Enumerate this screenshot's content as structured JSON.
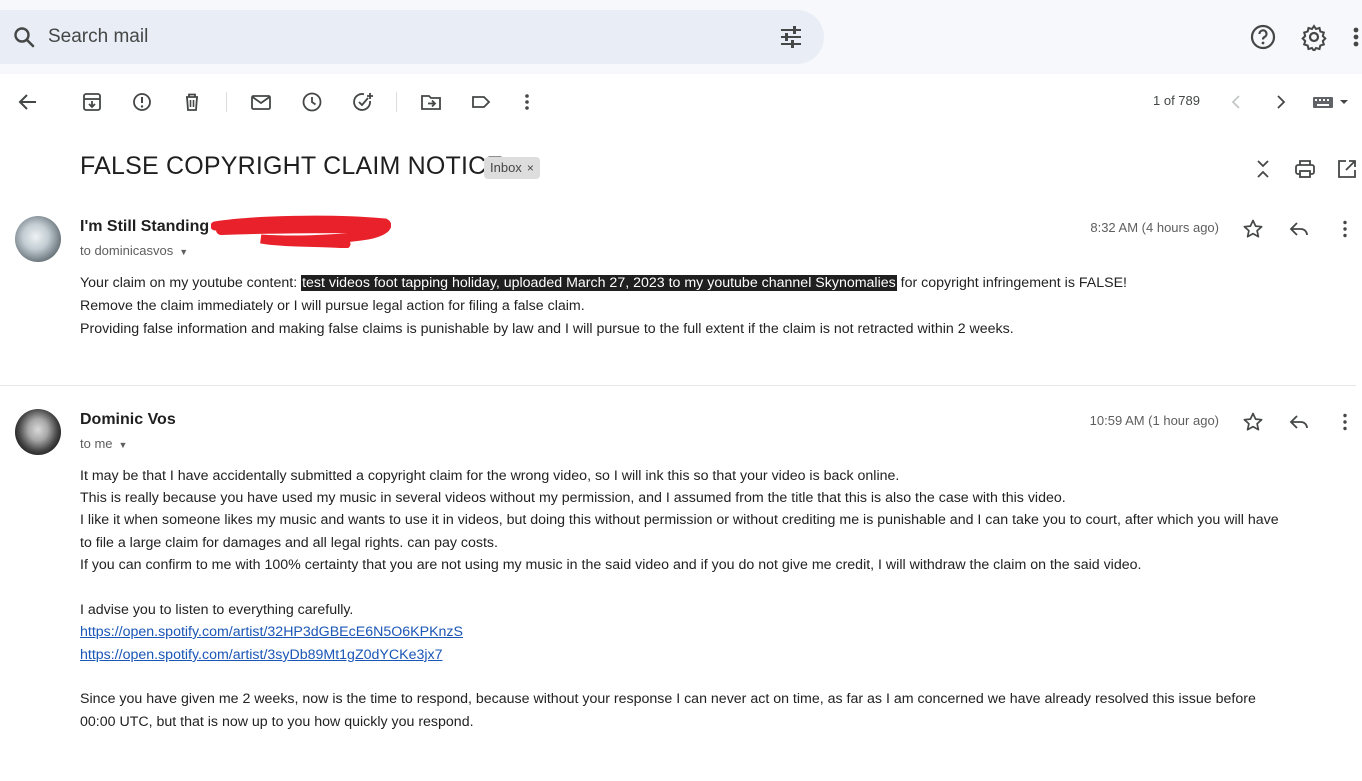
{
  "search": {
    "placeholder": "Search mail"
  },
  "toolbar": {
    "pager": "1 of 789"
  },
  "subject": "FALSE COPYRIGHT CLAIM NOTICE",
  "label": {
    "text": "Inbox",
    "close": "×"
  },
  "messages": [
    {
      "sender": "I'm Still Standing",
      "to": "to dominicasvos",
      "time": "8:32 AM (4 hours ago)",
      "lines": [
        {
          "pre": "Your claim on my youtube content: ",
          "highlight": "test videos foot tapping holiday, uploaded March 27, 2023 to my youtube channel Skynomalies",
          "post": " for copyright infringement is FALSE!"
        },
        "Remove the claim immediately or I will pursue legal action for filing a false claim.",
        "Providing false information and making false claims is punishable by law and I will pursue to the full extent if the claim is not retracted within 2 weeks."
      ]
    },
    {
      "sender": "Dominic Vos",
      "to": "to me",
      "time": "10:59 AM (1 hour ago)",
      "lines": [
        "It may be that I have accidentally submitted a copyright claim for the wrong video, so I will ink this so that your video is back online.",
        "This is really because you have used my music in several videos without my permission, and I assumed from the title that this is also the case with this video.",
        "I like it when someone likes my music and wants to use it in videos, but doing this without permission or without crediting me is punishable and I can take you to court, after which you will have",
        "to file a large claim for damages and all legal rights. can pay costs.",
        "If you can confirm to me with 100% certainty that you are not using my music in the said video and if you do not give me credit, I will withdraw the claim on the said video.",
        "I advise you to listen to everything carefully.",
        "https://open.spotify.com/artist/32HP3dGBEcE6N5O6KPKnzS",
        "https://open.spotify.com/artist/3syDb89Mt1gZ0dYCKe3jx7",
        "Since you have given me 2 weeks, now is the time to respond, because without your response I can never act on time, as far as I am concerned we have already resolved this issue before",
        "00:00 UTC, but that is now up to you how quickly you respond."
      ]
    }
  ],
  "colors": {
    "highlight_bg": "#1f1f1f",
    "link": "#1a56b6",
    "redaction": "#e8212b",
    "search_bg": "#e9eef6"
  }
}
